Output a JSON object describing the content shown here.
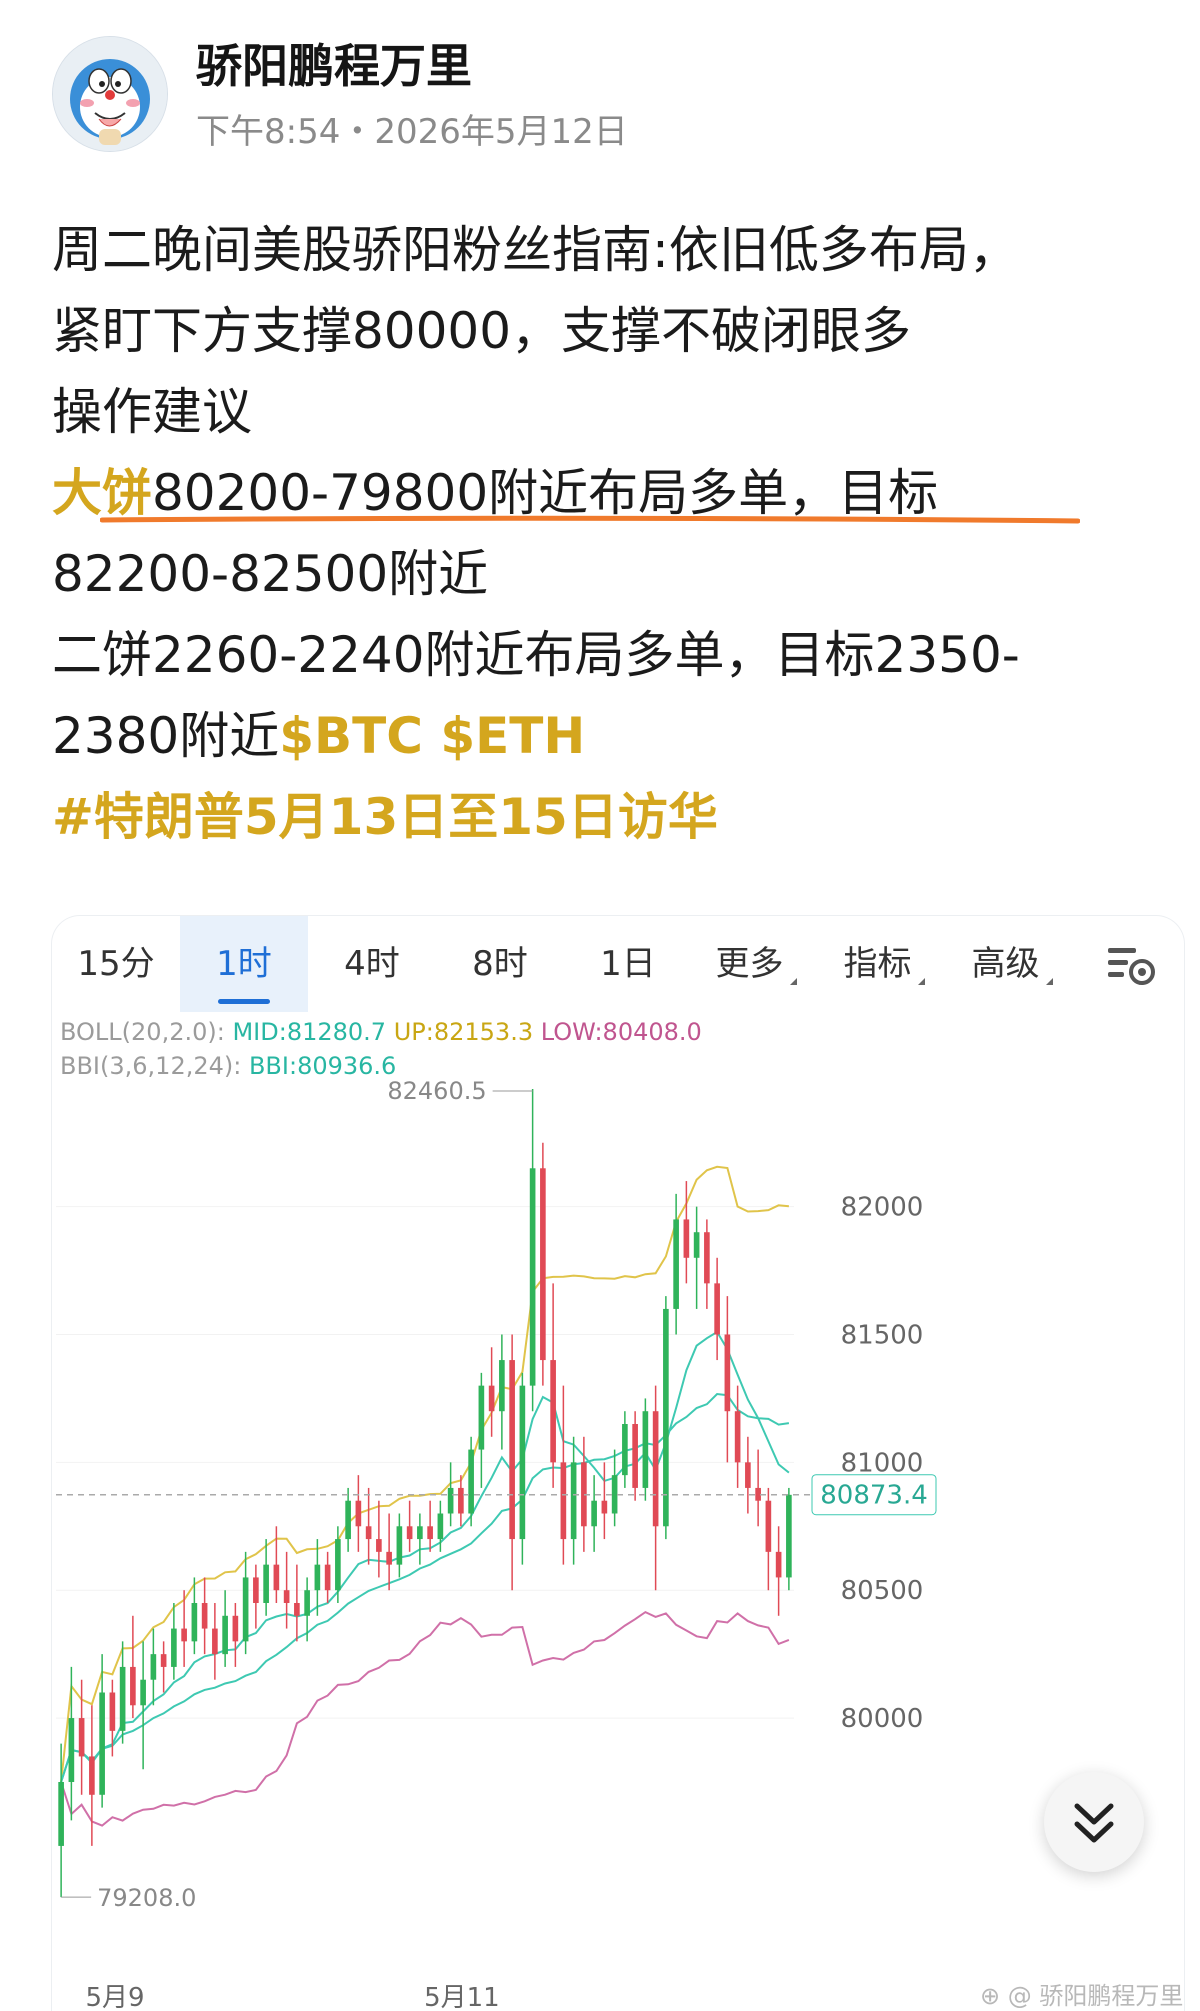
{
  "author": {
    "name": "骄阳鹏程万里",
    "timestamp": "下午8:54・2026年5月12日"
  },
  "post": {
    "line1": "周二晚间美股骄阳粉丝指南:依旧低多布局，",
    "line2": "紧盯下方支撑80000，支撑不破闭眼多",
    "line3": "操作建议",
    "line4_highlight": "大饼",
    "line4_rest": "80200-79800附近布局多单，目标",
    "line5": "82200-82500附近",
    "line6": "二饼2260-2240附近布局多单，目标2350-",
    "line7_text": "2380附近",
    "line7_tags": "$BTC $ETH",
    "hashtag": "#特朗普5月13日至15日访华"
  },
  "chart": {
    "tabs": [
      "15分",
      "1时",
      "4时",
      "8时",
      "1日",
      "更多",
      "指标",
      "高级"
    ],
    "active_tab": "1时",
    "settings_icon": "chart-settings-icon",
    "boll": {
      "label": "BOLL(20,2.0):",
      "mid": "MID:81280.7",
      "up": "UP:82153.3",
      "low": "LOW:80408.0"
    },
    "bbi": {
      "label": "BBI(3,6,12,24):",
      "value": "BBI:80936.6"
    },
    "high_label": "82460.5",
    "low_label": "79208.0",
    "current_price": "80873.4",
    "y_ticks": [
      "82000",
      "81500",
      "81000",
      "80500",
      "80000"
    ],
    "x_ticks": [
      "5月9",
      "5月11"
    ],
    "colors": {
      "up": "#2fb35a",
      "down": "#e04a55",
      "boll_up": "#e0c44a",
      "boll_mid": "#3ec9b2",
      "boll_low": "#d070a8",
      "bbi": "#3ec9b2"
    }
  },
  "chart_data": {
    "type": "candlestick",
    "ylim": [
      79050,
      82550
    ],
    "y_ticks": [
      82000,
      81500,
      81000,
      80500,
      80000
    ],
    "x_ticks": [
      "5月9",
      "5月11"
    ],
    "last_price": 80873.4,
    "candles_ohlc": [
      [
        79500,
        79900,
        79300,
        79750
      ],
      [
        79750,
        80200,
        79600,
        80000
      ],
      [
        80000,
        80150,
        79700,
        79850
      ],
      [
        79850,
        80050,
        79500,
        79700
      ],
      [
        79700,
        80250,
        79650,
        80100
      ],
      [
        80100,
        80150,
        79850,
        79950
      ],
      [
        79950,
        80300,
        79900,
        80200
      ],
      [
        80200,
        80400,
        80000,
        80050
      ],
      [
        80050,
        80300,
        79800,
        80150
      ],
      [
        80150,
        80350,
        80050,
        80250
      ],
      [
        80250,
        80300,
        80100,
        80200
      ],
      [
        80200,
        80450,
        80150,
        80350
      ],
      [
        80350,
        80500,
        80200,
        80300
      ],
      [
        80300,
        80550,
        80250,
        80450
      ],
      [
        80450,
        80550,
        80250,
        80350
      ],
      [
        80350,
        80450,
        80150,
        80250
      ],
      [
        80250,
        80500,
        80200,
        80400
      ],
      [
        80400,
        80450,
        80200,
        80300
      ],
      [
        80300,
        80650,
        80250,
        80550
      ],
      [
        80550,
        80600,
        80350,
        80450
      ],
      [
        80450,
        80700,
        80400,
        80600
      ],
      [
        80600,
        80750,
        80450,
        80500
      ],
      [
        80500,
        80650,
        80350,
        80450
      ],
      [
        80450,
        80600,
        80300,
        80400
      ],
      [
        80400,
        80550,
        80300,
        80500
      ],
      [
        80500,
        80700,
        80400,
        80600
      ],
      [
        80600,
        80650,
        80450,
        80500
      ],
      [
        80500,
        80750,
        80450,
        80700
      ],
      [
        80700,
        80900,
        80650,
        80850
      ],
      [
        80850,
        80950,
        80650,
        80750
      ],
      [
        80750,
        80900,
        80600,
        80700
      ],
      [
        80700,
        80850,
        80550,
        80650
      ],
      [
        80650,
        80800,
        80500,
        80600
      ],
      [
        80600,
        80800,
        80550,
        80750
      ],
      [
        80750,
        80850,
        80650,
        80700
      ],
      [
        80700,
        80800,
        80600,
        80750
      ],
      [
        80750,
        80850,
        80650,
        80700
      ],
      [
        80700,
        80850,
        80650,
        80800
      ],
      [
        80800,
        81000,
        80750,
        80900
      ],
      [
        80900,
        80950,
        80750,
        80800
      ],
      [
        80800,
        81100,
        80750,
        81050
      ],
      [
        81050,
        81350,
        80900,
        81300
      ],
      [
        81300,
        81450,
        81100,
        81200
      ],
      [
        81200,
        81500,
        81050,
        81400
      ],
      [
        81400,
        81500,
        80500,
        80700
      ],
      [
        80700,
        81350,
        80600,
        81300
      ],
      [
        81300,
        82460,
        81200,
        82150
      ],
      [
        82150,
        82250,
        81300,
        81400
      ],
      [
        81400,
        81700,
        80900,
        81000
      ],
      [
        81000,
        81300,
        80600,
        80700
      ],
      [
        80700,
        81100,
        80600,
        81000
      ],
      [
        81000,
        81100,
        80650,
        80750
      ],
      [
        80750,
        80950,
        80650,
        80850
      ],
      [
        80850,
        81000,
        80700,
        80800
      ],
      [
        80800,
        81050,
        80750,
        80950
      ],
      [
        80950,
        81200,
        80900,
        81150
      ],
      [
        81150,
        81200,
        80850,
        80900
      ],
      [
        80900,
        81250,
        80850,
        81200
      ],
      [
        81200,
        81300,
        80500,
        80750
      ],
      [
        80750,
        81650,
        80700,
        81600
      ],
      [
        81600,
        82050,
        81500,
        81950
      ],
      [
        81950,
        82100,
        81700,
        81800
      ],
      [
        81800,
        82000,
        81600,
        81900
      ],
      [
        81900,
        81950,
        81600,
        81700
      ],
      [
        81700,
        81800,
        81400,
        81500
      ],
      [
        81500,
        81650,
        81000,
        81200
      ],
      [
        81200,
        81300,
        80900,
        81000
      ],
      [
        81000,
        81100,
        80800,
        80900
      ],
      [
        80900,
        81050,
        80750,
        80850
      ],
      [
        80850,
        80900,
        80500,
        80650
      ],
      [
        80650,
        80750,
        80400,
        80550
      ],
      [
        80550,
        80900,
        80500,
        80873
      ]
    ]
  }
}
